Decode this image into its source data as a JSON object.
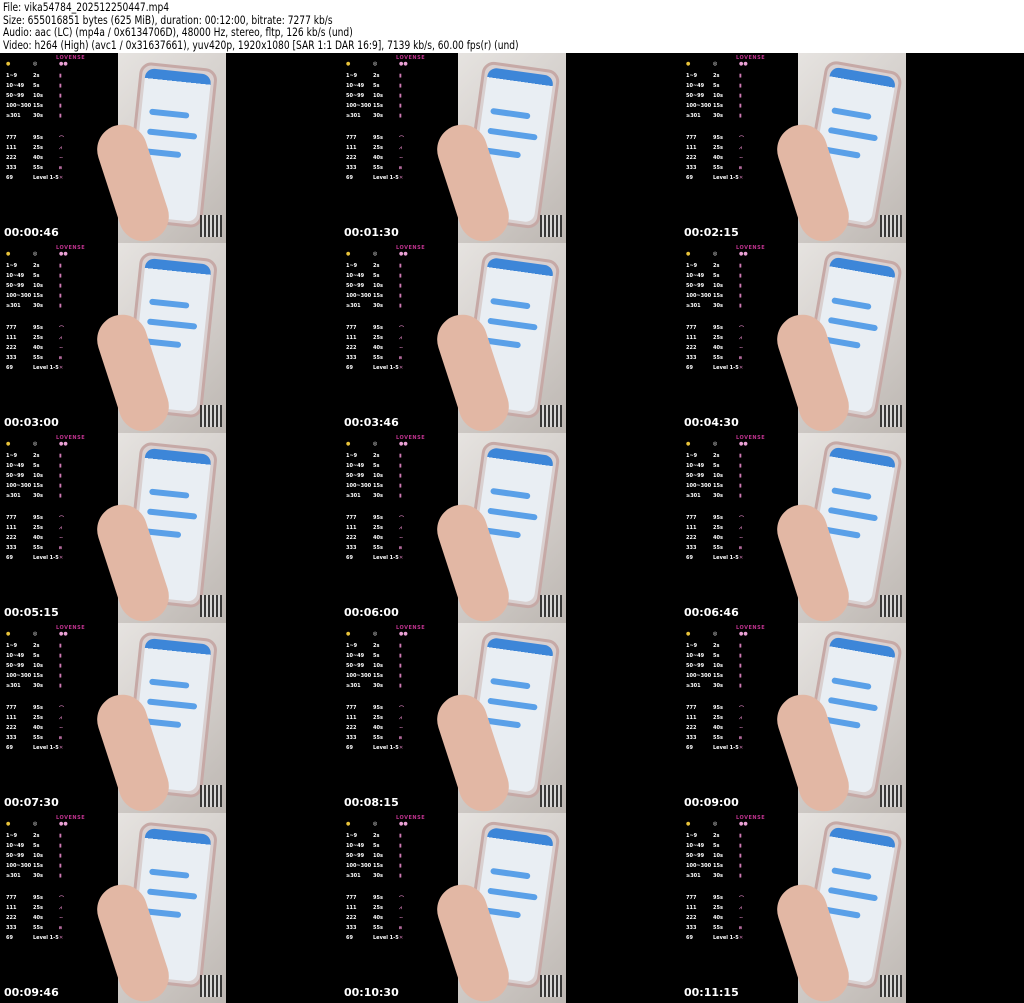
{
  "header": {
    "file": "File: vika54784_202512250447.mp4",
    "size": "Size: 655016851 bytes (625 MiB), duration: 00:12:00, bitrate: 7277 kb/s",
    "audio": "Audio: aac (LC) (mp4a / 0x6134706D), 48000 Hz, stereo, fltp, 126 kb/s (und)",
    "video": "Video: h264 (High) (avc1 / 0x31637661), yuv420p, 1920x1080 [SAR 1:1 DAR 16:9], 7139 kb/s, 60.00 fps(r) (und)"
  },
  "overlay": {
    "brand": "LOVENSE",
    "icons": [
      "tokens-icon",
      "timer-icon",
      "toy-icon"
    ],
    "rows": [
      [
        "1~9",
        "2s",
        "▮"
      ],
      [
        "10~49",
        "5s",
        "▮"
      ],
      [
        "50~99",
        "10s",
        "▮"
      ],
      [
        "100~300",
        "15s",
        "▮"
      ],
      [
        "≥301",
        "30s",
        "▮"
      ],
      [
        "777",
        "95s",
        "⌒"
      ],
      [
        "111",
        "25s",
        "⩘"
      ],
      [
        "222",
        "40s",
        "∼"
      ],
      [
        "333",
        "55s",
        "⩎"
      ],
      [
        "69",
        "Level 1-5",
        "✕"
      ]
    ]
  },
  "timestamps": [
    "00:00:46",
    "00:01:30",
    "00:02:15",
    "00:03:00",
    "00:03:46",
    "00:04:30",
    "00:05:15",
    "00:06:00",
    "00:06:46",
    "00:07:30",
    "00:08:15",
    "00:09:00",
    "00:09:46",
    "00:10:30",
    "00:11:15"
  ],
  "colors": {
    "brand": "#c0338f",
    "background": "#000000",
    "timestamp": "#ffffff"
  }
}
